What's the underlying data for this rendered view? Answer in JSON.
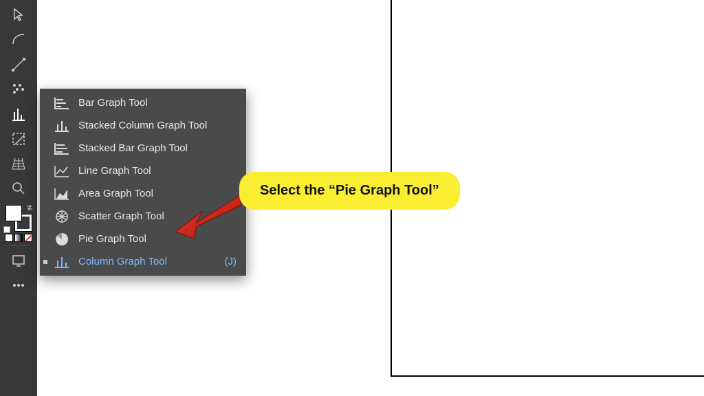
{
  "toolbar": {
    "tools": [
      {
        "name": "selection-tool-icon"
      },
      {
        "name": "pen-tool-icon"
      },
      {
        "name": "curvature-tool-icon"
      },
      {
        "name": "width-tool-icon"
      },
      {
        "name": "graph-tool-icon"
      },
      {
        "name": "slice-tool-icon"
      },
      {
        "name": "perspective-grid-icon"
      },
      {
        "name": "zoom-tool-icon"
      }
    ]
  },
  "flyout": {
    "items": [
      {
        "label": "Bar Graph Tool",
        "icon": "bar-graph-icon"
      },
      {
        "label": "Stacked Column Graph Tool",
        "icon": "stacked-column-graph-icon"
      },
      {
        "label": "Stacked Bar Graph Tool",
        "icon": "stacked-bar-graph-icon"
      },
      {
        "label": "Line Graph Tool",
        "icon": "line-graph-icon"
      },
      {
        "label": "Area Graph Tool",
        "icon": "area-graph-icon"
      },
      {
        "label": "Scatter Graph Tool",
        "icon": "scatter-graph-icon"
      },
      {
        "label": "Pie Graph Tool",
        "icon": "pie-graph-icon"
      },
      {
        "label": "Column Graph Tool",
        "icon": "column-graph-icon",
        "shortcut": "(J)",
        "active": true
      }
    ]
  },
  "callout": {
    "text": "Select the “Pie Graph Tool”"
  }
}
